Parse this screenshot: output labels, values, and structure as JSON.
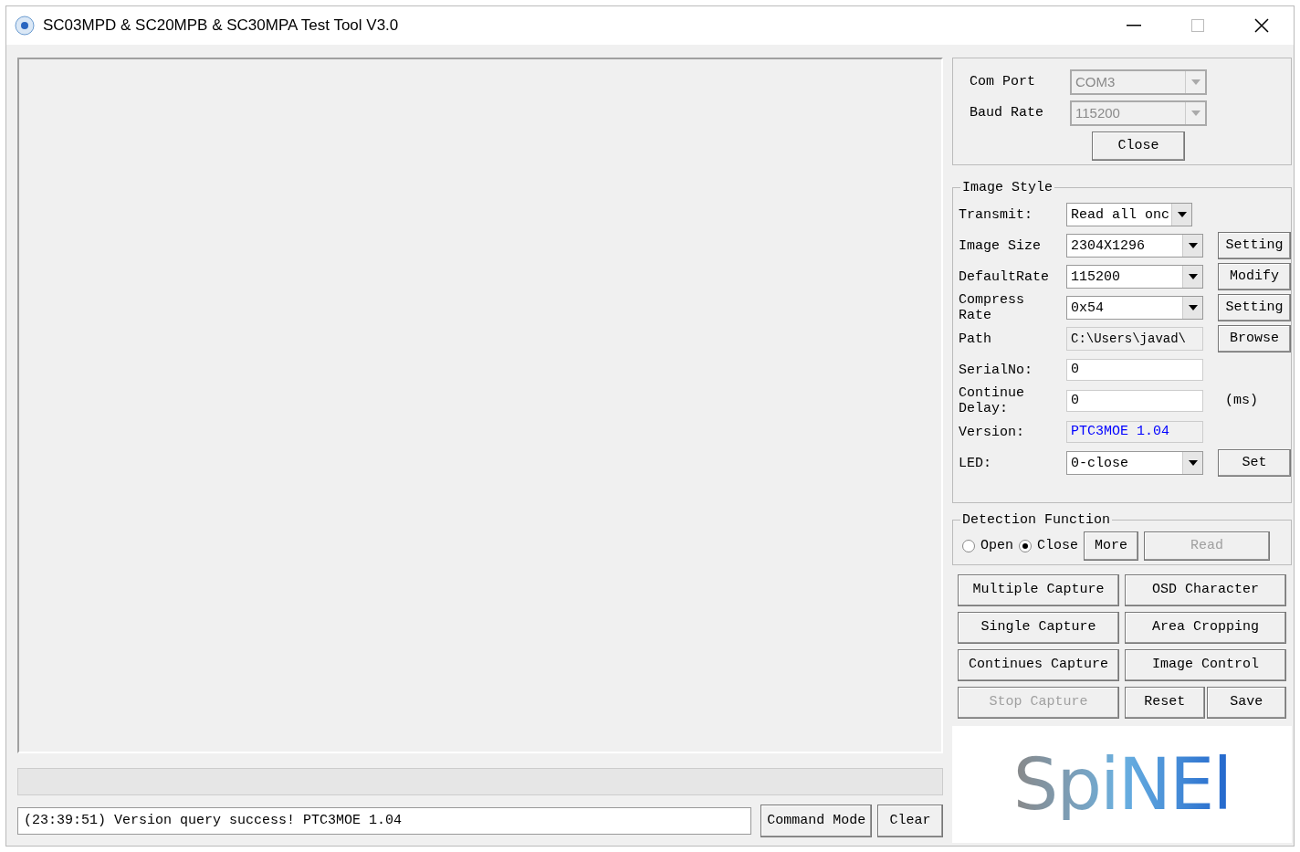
{
  "window": {
    "title": "SC03MPD & SC20MPB & SC30MPA Test Tool V3.0"
  },
  "connection": {
    "fields": [
      {
        "label": "Com Port",
        "value": "COM3",
        "disabled": true
      },
      {
        "label": "Baud Rate",
        "value": "115200",
        "disabled": true
      }
    ],
    "button": "Close"
  },
  "image_style": {
    "title": "Image Style",
    "rows": [
      {
        "kind": "select",
        "label": "Transmit:",
        "value": "Read all onc"
      },
      {
        "kind": "select",
        "label": "Image Size",
        "value": "2304X1296",
        "button": "Setting"
      },
      {
        "kind": "select",
        "label": "DefaultRate",
        "value": "115200",
        "button": "Modify"
      },
      {
        "kind": "select",
        "label": "Compress Rate",
        "value": "0x54",
        "button": "Setting"
      },
      {
        "kind": "readonly",
        "label": "Path",
        "value": "C:\\Users\\javad\\",
        "button": "Browse"
      },
      {
        "kind": "input",
        "label": "SerialNo:",
        "value": "0"
      },
      {
        "kind": "input",
        "label": "Continue Delay:",
        "value": "0",
        "unit": "(ms)"
      },
      {
        "kind": "info",
        "label": "Version:",
        "value": "PTC3MOE 1.04"
      },
      {
        "kind": "select",
        "label": "LED:",
        "value": "0-close",
        "button": "Set"
      }
    ]
  },
  "detection": {
    "title": "Detection Function",
    "radios": [
      {
        "label": "Open",
        "selected": false
      },
      {
        "label": "Close",
        "selected": true
      }
    ],
    "buttons": [
      {
        "label": "More",
        "disabled": false
      },
      {
        "label": "Read",
        "disabled": true
      }
    ]
  },
  "actions": [
    [
      {
        "label": "Multiple Capture",
        "disabled": false
      }
    ],
    [
      {
        "label": "OSD Character",
        "disabled": false
      }
    ],
    [
      {
        "label": "Single Capture",
        "disabled": false
      }
    ],
    [
      {
        "label": "Area Cropping",
        "disabled": false
      }
    ],
    [
      {
        "label": "Continues Capture",
        "disabled": false
      }
    ],
    [
      {
        "label": "Image Control",
        "disabled": false
      }
    ],
    [
      {
        "label": "Stop Capture",
        "disabled": true
      }
    ],
    [
      {
        "label": "Reset",
        "disabled": false
      },
      {
        "label": "Save",
        "disabled": false
      }
    ]
  ],
  "logo": "SpiNEl",
  "progress": {
    "level": 0
  },
  "log": {
    "value": "(23:39:51) Version query success! PTC3MOE 1.04",
    "buttons": [
      "Command Mode",
      "Clear"
    ]
  }
}
